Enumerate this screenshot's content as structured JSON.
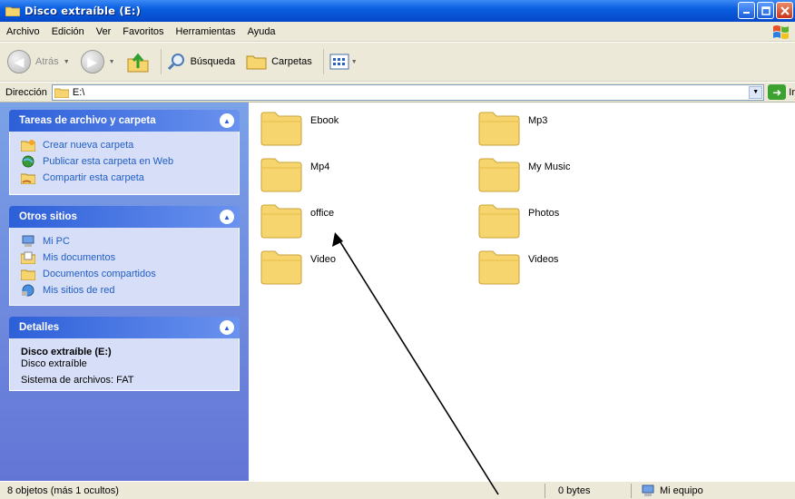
{
  "window": {
    "title": "Disco extraíble (E:)"
  },
  "menu": [
    "Archivo",
    "Edición",
    "Ver",
    "Favoritos",
    "Herramientas",
    "Ayuda"
  ],
  "toolbar": {
    "back_label": "Atrás",
    "search_label": "Búsqueda",
    "folders_label": "Carpetas"
  },
  "address": {
    "label": "Dirección",
    "value": "E:\\",
    "go_label": "Ir"
  },
  "panels": {
    "tasks": {
      "title": "Tareas de archivo y carpeta",
      "items": [
        "Crear nueva carpeta",
        "Publicar esta carpeta en Web",
        "Compartir esta carpeta"
      ]
    },
    "places": {
      "title": "Otros sitios",
      "items": [
        "Mi PC",
        "Mis documentos",
        "Documentos compartidos",
        "Mis sitios de red"
      ]
    },
    "details": {
      "title": "Detalles",
      "name": "Disco extraíble (E:)",
      "type": "Disco extraíble",
      "filesystem": "Sistema de archivos: FAT"
    }
  },
  "folders": [
    "Ebook",
    "Mp3",
    "Mp4",
    "My Music",
    "office",
    "Photos",
    "Video",
    "Videos"
  ],
  "status": {
    "objects": "8 objetos (más 1 ocultos)",
    "size": "0 bytes",
    "location": "Mi equipo"
  },
  "colors": {
    "titlebar": "#0a5fe0",
    "task_link": "#215dc6",
    "panel_body": "#d6dff7",
    "folder": "#f6d56f"
  }
}
